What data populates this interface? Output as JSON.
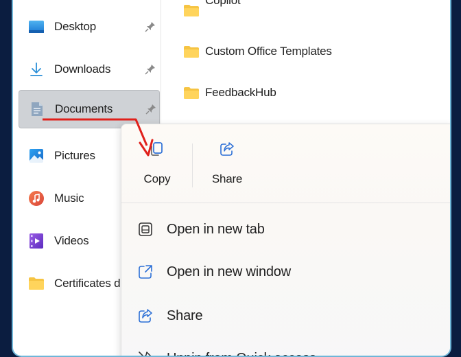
{
  "sidebar": {
    "items": [
      {
        "label": "Desktop",
        "icon": "desktop-icon",
        "pinned": true
      },
      {
        "label": "Downloads",
        "icon": "download-icon",
        "pinned": true
      },
      {
        "label": "Documents",
        "icon": "documents-icon",
        "pinned": true,
        "selected": true
      },
      {
        "label": "Pictures",
        "icon": "pictures-icon",
        "pinned": false
      },
      {
        "label": "Music",
        "icon": "music-icon",
        "pinned": false
      },
      {
        "label": "Videos",
        "icon": "videos-icon",
        "pinned": false
      },
      {
        "label": "Certificates d",
        "icon": "folder-icon",
        "pinned": false
      }
    ]
  },
  "files": {
    "items": [
      {
        "name": "Copilot",
        "icon": "folder-icon"
      },
      {
        "name": "Custom Office Templates",
        "icon": "folder-icon"
      },
      {
        "name": "FeedbackHub",
        "icon": "folder-icon"
      }
    ]
  },
  "context_menu": {
    "top_actions": [
      {
        "label": "Copy",
        "icon": "copy-icon"
      },
      {
        "label": "Share",
        "icon": "share-icon"
      }
    ],
    "items": [
      {
        "label": "Open in new tab",
        "icon": "open-new-tab-icon"
      },
      {
        "label": "Open in new window",
        "icon": "open-new-window-icon"
      },
      {
        "label": "Share",
        "icon": "share-icon"
      },
      {
        "label": "Unpin from Quick access",
        "icon": "unpin-icon"
      }
    ]
  },
  "colors": {
    "background": "#0b1d40",
    "frame_border": "#6fb6d8",
    "selected_item": "#cfd2d6",
    "folder": "#f6c443",
    "annotation_arrow": "#e0201b"
  }
}
